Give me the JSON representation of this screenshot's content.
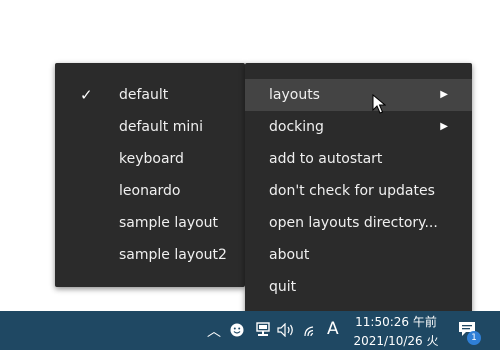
{
  "left_menu": {
    "items": [
      {
        "label": "default",
        "checked": true
      },
      {
        "label": "default mini",
        "checked": false
      },
      {
        "label": "keyboard",
        "checked": false
      },
      {
        "label": "leonardo",
        "checked": false
      },
      {
        "label": "sample layout",
        "checked": false
      },
      {
        "label": "sample layout2",
        "checked": false
      }
    ]
  },
  "right_menu": {
    "items": [
      {
        "label": "layouts",
        "has_submenu": true,
        "highlighted": true
      },
      {
        "label": "docking",
        "has_submenu": true
      },
      {
        "label": "add to autostart"
      },
      {
        "label": "don't check for updates"
      },
      {
        "label": "open layouts directory..."
      },
      {
        "label": "about"
      },
      {
        "label": "quit"
      }
    ]
  },
  "taskbar": {
    "ime_label": "A",
    "time": "11:50:26 午前",
    "date": "2021/10/26 火",
    "notification_count": "1"
  },
  "colors": {
    "menu_bg": "#2b2b2b",
    "menu_highlight": "#444444",
    "taskbar_bg": "#1f4863",
    "badge_bg": "#2f7fd6"
  },
  "icons": [
    "check-icon",
    "chevron-right-icon",
    "chevron-up-icon",
    "smiley-icon",
    "network-icon",
    "volume-icon",
    "wifi-icon",
    "notification-icon",
    "cursor-icon"
  ]
}
